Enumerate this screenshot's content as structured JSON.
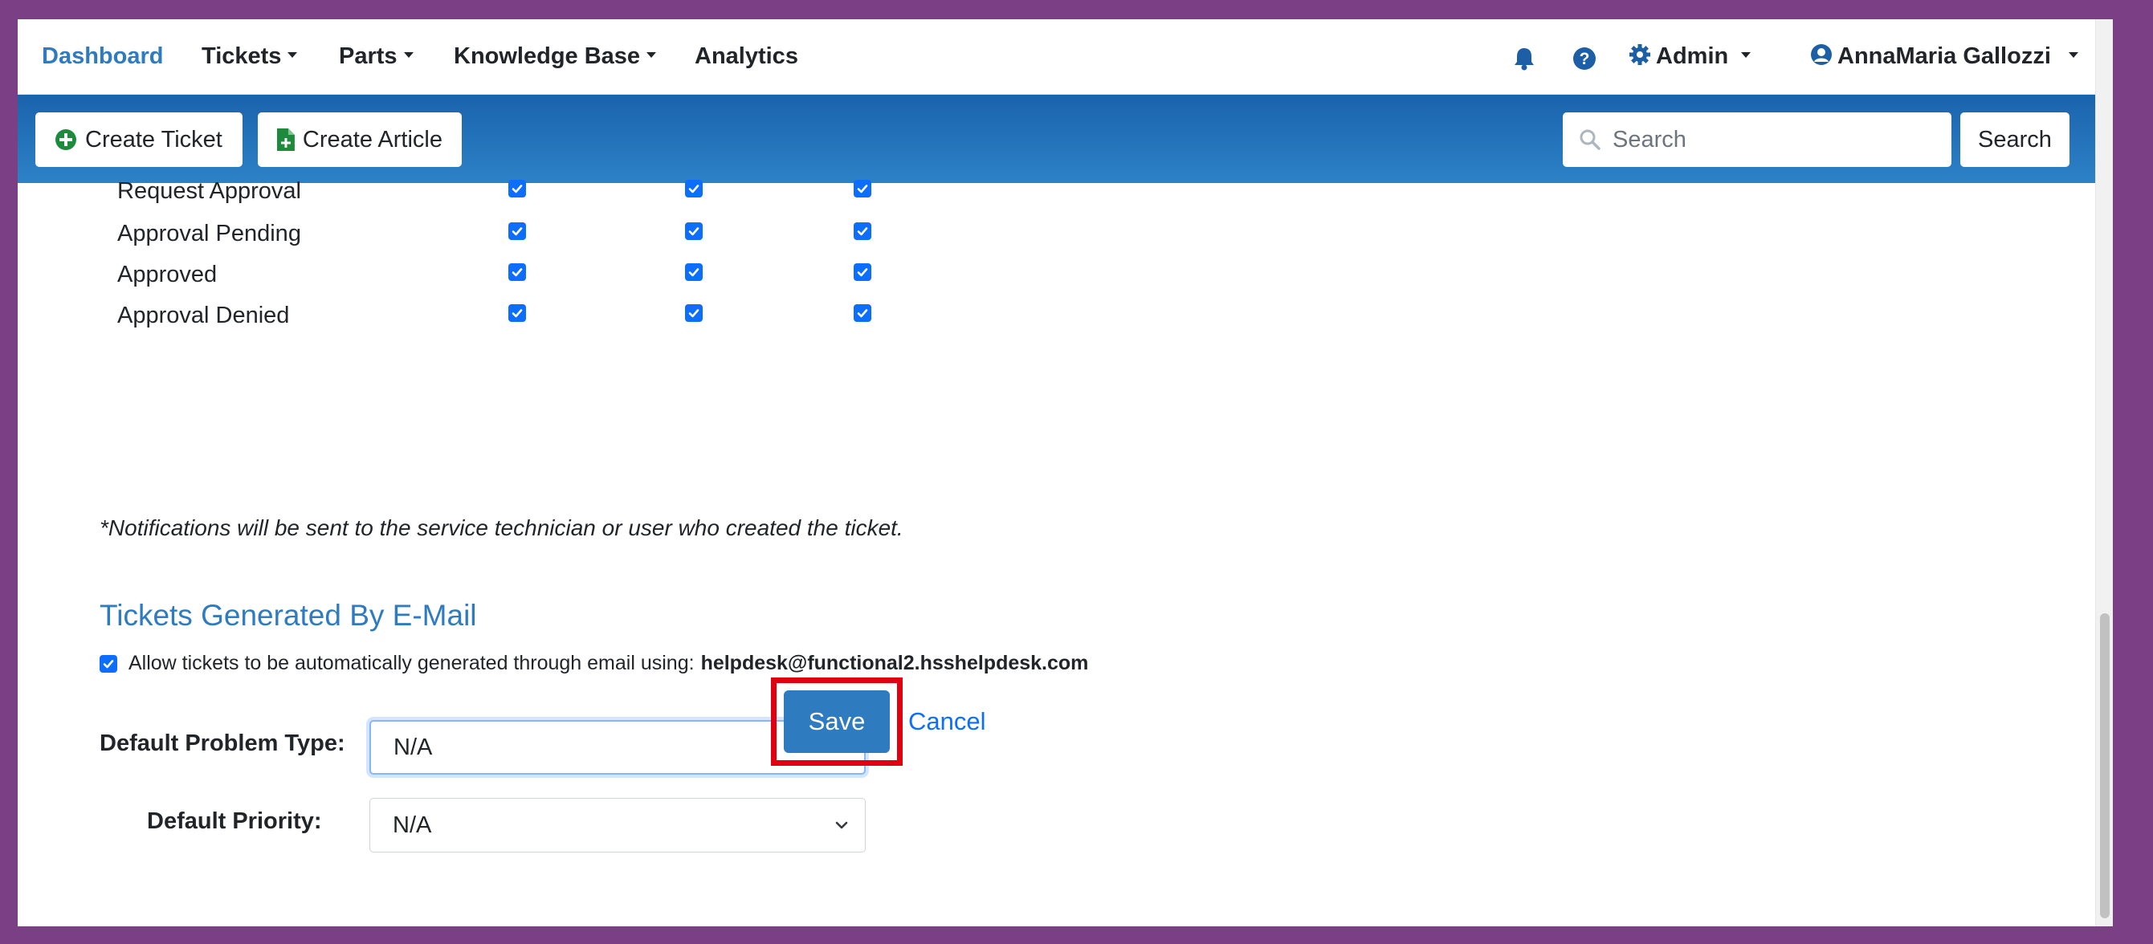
{
  "nav": {
    "dashboard": "Dashboard",
    "tickets": "Tickets",
    "parts": "Parts",
    "knowledge_base": "Knowledge Base",
    "analytics": "Analytics",
    "admin": "Admin",
    "user": "AnnaMaria Gallozzi"
  },
  "toolbar": {
    "create_ticket": "Create Ticket",
    "create_article": "Create Article",
    "search_placeholder": "Search",
    "search_button": "Search"
  },
  "notification_rows": [
    {
      "label": "Request Approval",
      "checks": [
        true,
        true,
        true
      ]
    },
    {
      "label": "Approval Pending",
      "checks": [
        true,
        true,
        true
      ]
    },
    {
      "label": "Approved",
      "checks": [
        true,
        true,
        true
      ]
    },
    {
      "label": "Approval Denied",
      "checks": [
        true,
        true,
        true
      ]
    }
  ],
  "note": "*Notifications will be sent to the service technician or user who created the ticket.",
  "email_section": {
    "title": "Tickets Generated By E-Mail",
    "allow_text": "Allow tickets to be automatically generated through email using:",
    "allow_email": "helpdesk@functional2.hsshelpdesk.com",
    "allow_checked": true,
    "problem_type_label": "Default Problem Type:",
    "problem_type_value": "N/A",
    "priority_label": "Default Priority:",
    "priority_value": "N/A"
  },
  "actions": {
    "save": "Save",
    "cancel": "Cancel"
  },
  "colors": {
    "accent": "#2f7bbf",
    "toolbar": "#1a63ad",
    "checkbox": "#0d6efd",
    "highlight": "#e0000f",
    "frame": "#7b3f86"
  }
}
